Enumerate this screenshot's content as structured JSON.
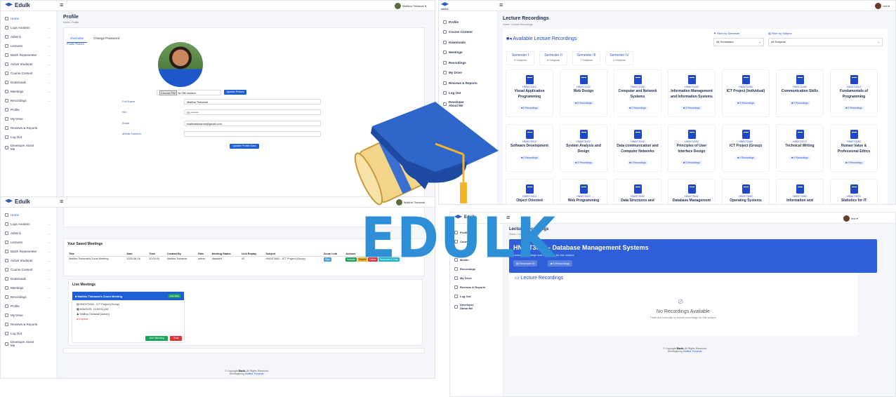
{
  "brand": {
    "name": "Edulk",
    "logo_sub": "EDULK"
  },
  "logo_center": {
    "text": "EDULK"
  },
  "sidebar_a": {
    "items": [
      {
        "label": "Home",
        "icon": "home-icon",
        "chev": false
      },
      {
        "label": "Logs Analysis",
        "icon": "logs-icon",
        "chev": true
      },
      {
        "label": "Admins",
        "icon": "admins-icon",
        "chev": true
      },
      {
        "label": "Lectures",
        "icon": "lectures-icon",
        "chev": true
      },
      {
        "label": "Batch Representer",
        "icon": "batch-icon",
        "chev": true
      },
      {
        "label": "Active Students",
        "icon": "students-icon",
        "chev": true
      },
      {
        "label": "Course Content",
        "icon": "course-icon",
        "chev": true
      },
      {
        "label": "Downloads",
        "icon": "download-icon",
        "chev": true
      },
      {
        "label": "Meetings",
        "icon": "meetings-icon",
        "chev": true
      },
      {
        "label": "Recordings",
        "icon": "recordings-icon",
        "chev": true
      },
      {
        "label": "Profile",
        "icon": "profile-icon",
        "chev": false
      },
      {
        "label": "My Drive",
        "icon": "drive-icon",
        "chev": false
      },
      {
        "label": "Reviews & Reports",
        "icon": "reviews-icon",
        "chev": false
      },
      {
        "label": "Log Out",
        "icon": "logout-icon",
        "chev": false
      },
      {
        "label": "Developer About Me",
        "icon": "developer-icon",
        "chev": false
      }
    ]
  },
  "sidebar_b": {
    "items": [
      {
        "label": "Profile",
        "icon": "profile-icon"
      },
      {
        "label": "Course Content",
        "icon": "course-icon"
      },
      {
        "label": "Downloads",
        "icon": "download-icon"
      },
      {
        "label": "Meetings",
        "icon": "meetings-icon"
      },
      {
        "label": "Recordings",
        "icon": "recordings-icon"
      },
      {
        "label": "My Drive",
        "icon": "drive-icon"
      },
      {
        "label": "Reviews & Reports",
        "icon": "reviews-icon"
      },
      {
        "label": "Log Out",
        "icon": "logout-icon"
      },
      {
        "label": "Developer About Me",
        "icon": "developer-icon"
      }
    ]
  },
  "sidebar_c": {
    "items": [
      {
        "label": "Profile"
      },
      {
        "label": "Course"
      },
      {
        "label": "Downl"
      },
      {
        "label": "Meetin"
      },
      {
        "label": "Recordings"
      },
      {
        "label": "My Drive"
      },
      {
        "label": "Reviews & Reports"
      },
      {
        "label": "Log Out"
      },
      {
        "label": "Developer About Me"
      }
    ]
  },
  "profile": {
    "title": "Profile",
    "breadcrumb": "Home / Profile",
    "user": "Maliitha Tishamal",
    "tabs": [
      "Overview",
      "Change Password"
    ],
    "picture_label": "Profile Picture",
    "choose_file": "Choose File",
    "no_file": "No file chosen",
    "update_picture": "Update Picture",
    "fields": [
      {
        "label": "Full Name",
        "value": "Malitha Tishamal"
      },
      {
        "label": "NIC",
        "value": "20 *******"
      },
      {
        "label": "Email",
        "value": "malithatishamal@gmail.com"
      },
      {
        "label": "Mobile Number",
        "value": ""
      }
    ],
    "update_profile": "Update Profile Data"
  },
  "meetings": {
    "user": "Malitha Tishamal",
    "saved_title": "Your Saved Meetings",
    "columns": [
      "Title",
      "Date",
      "Time",
      "Created By",
      "Role",
      "Meeting Status",
      "Link Replay",
      "Subject",
      "Zoom Link",
      "Actions"
    ],
    "rows": [
      {
        "title": "Malitha Tishamal's Zoom Meeting",
        "date": "2025-08-26",
        "time": "10:00:00",
        "created_by": "Malitha Tishamal",
        "role": "admin",
        "status": "disabled",
        "replay": "40",
        "subject": "HNDIT2062 - ICT Project (Group)",
        "zoom": "Start",
        "actions": [
          "Activate",
          "Disable",
          "Delete",
          "Resources & Chat"
        ]
      }
    ],
    "live_title": "Live Meetings",
    "live_card": {
      "name": "Malitha Tishamal's Zoom Meeting",
      "badge": "Live Now",
      "subject": "HNDIT2062 - ICT Project (Group)",
      "datetime": "8/26/2025, 10:00:00 AM",
      "host": "Malitha Tishamal (admin)",
      "status": "Expired",
      "join": "Join Meeting",
      "end": "End"
    },
    "footer_copy": "© Copyright",
    "footer_brand": "Edulk.",
    "footer_rights": "All Rights Reserved",
    "footer_dev": "Developed by",
    "footer_dev_name": "Malitha Tishamal"
  },
  "recordings": {
    "title": "Lecture Recordings",
    "breadcrumb": "Home / Lecture Recordings",
    "user": "test",
    "section": "Available Lecture Recordings",
    "filter_sem_label": "Filter by Semester",
    "filter_sem_value": "All Semesters",
    "filter_sub_label": "Filter by Subject",
    "filter_sub_value": "All Subjects",
    "semesters": [
      {
        "name": "Semester I",
        "count": "6 Subjects"
      },
      {
        "name": "Semester II",
        "count": "6 Subjects"
      },
      {
        "name": "Semester III",
        "count": "7 Subjects"
      },
      {
        "name": "Semester IV",
        "count": "0 Subjects"
      }
    ],
    "subjects": [
      {
        "code": "HNDIT1012",
        "name": "Visual Application Programming",
        "rec": "0 Recordings"
      },
      {
        "code": "HNDIT1022",
        "name": "Web Design",
        "rec": "0 Recordings"
      },
      {
        "code": "HNDIT1032",
        "name": "Computer and Network Systems",
        "rec": "0 Recordings"
      },
      {
        "code": "HNDIT1042",
        "name": "Information Management and Information Systems",
        "rec": "0 Recordings"
      },
      {
        "code": "HNDIT1052",
        "name": "ICT Project (Individual)",
        "rec": "0 Recordings"
      },
      {
        "code": "HNDIT1062",
        "name": "Communication Skills",
        "rec": "0 Recordings"
      },
      {
        "code": "HNDIT2012",
        "name": "Fundamentals of Programming",
        "rec": "0 Recordings"
      },
      {
        "code": "HNDIT2022",
        "name": "Software Development",
        "rec": "0 Recordings"
      },
      {
        "code": "HNDIT2032",
        "name": "System Analysis and Design",
        "rec": "0 Recordings"
      },
      {
        "code": "HNDIT2042",
        "name": "Data communication and Computer Networks",
        "rec": "0 Recordings"
      },
      {
        "code": "HNDIT2052",
        "name": "Principles of User Interface Design",
        "rec": "0 Recordings"
      },
      {
        "code": "HNDIT2062",
        "name": "ICT Project (Group)",
        "rec": "0 Recordings"
      },
      {
        "code": "HNDIT2072",
        "name": "Technical Writing",
        "rec": "0 Recordings"
      },
      {
        "code": "HNDIT2082",
        "name": "Human Value & Professional Ethics",
        "rec": "0 Recordings"
      },
      {
        "code": "HNDIT3012",
        "name": "Object Oriented",
        "rec": ""
      },
      {
        "code": "HNDIT3022",
        "name": "Web Programming",
        "rec": ""
      },
      {
        "code": "HNDIT3032",
        "name": "Data Structures and",
        "rec": ""
      },
      {
        "code": "HNDIT3042",
        "name": "Database Management",
        "rec": ""
      },
      {
        "code": "HNDIT3052",
        "name": "Operating Systems",
        "rec": ""
      },
      {
        "code": "HNDIT3062",
        "name": "Information and",
        "rec": ""
      },
      {
        "code": "HNDIT3072",
        "name": "Statistics for IT",
        "rec": ""
      }
    ]
  },
  "subject_detail": {
    "title": "Lecture Recordings",
    "breadcrumb": "Home / Lecture Recordings",
    "user": "test",
    "banner_title": "HNDIT3042 - Database Management Systems",
    "banner_sub": "Lecture recordings and resources for this subject",
    "chip_sem": "Semester III",
    "chip_rec": "0 Recordings",
    "section": "Lecture Recordings",
    "empty_title": "No Recordings Available",
    "empty_sub": "There are currently no lecture recordings for this subject.",
    "footer_copy": "© Copyright",
    "footer_brand": "Edulk.",
    "footer_rights": "All Rights Reserved",
    "footer_dev": "Developed by",
    "footer_dev_name": "Malitha Tishamal"
  },
  "colors": {
    "primary": "#1f5fd6",
    "banner": "#2f5fd8",
    "navy": "#1e2a4a",
    "gold": "#f3b52a"
  }
}
